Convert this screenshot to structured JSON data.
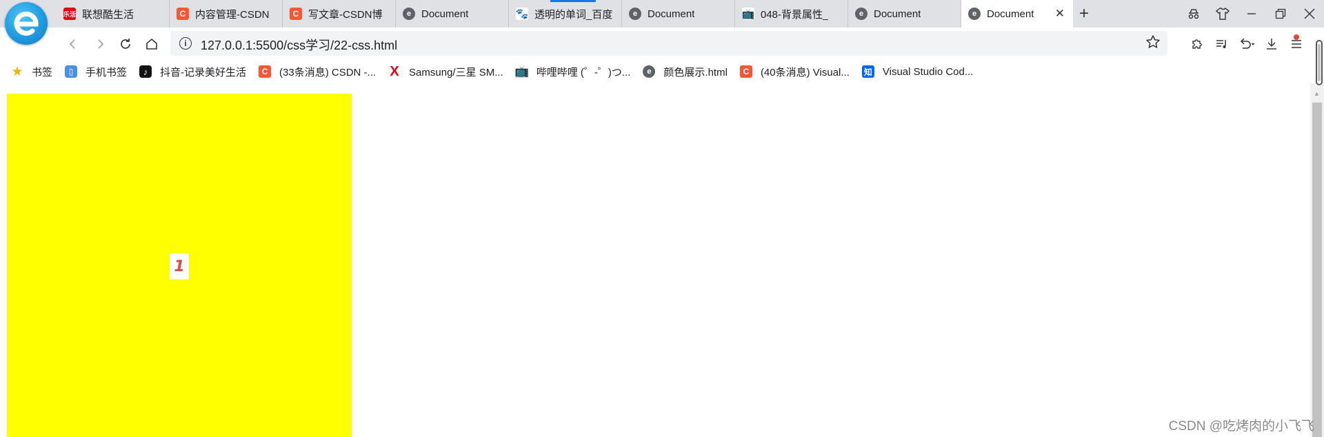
{
  "browser": {
    "tabs": [
      {
        "title": "联想酷生活",
        "favicon": "lenovo-icon",
        "favicon_text": "乐活"
      },
      {
        "title": "内容管理-CSDN",
        "favicon": "csdn-icon",
        "favicon_text": "C"
      },
      {
        "title": "写文章-CSDN博",
        "favicon": "csdn-icon",
        "favicon_text": "C"
      },
      {
        "title": "Document",
        "favicon": "document-icon",
        "favicon_text": "e"
      },
      {
        "title": "透明的单词_百度",
        "favicon": "baidu-icon",
        "favicon_text": "🐾"
      },
      {
        "title": "Document",
        "favicon": "document-icon",
        "favicon_text": "e"
      },
      {
        "title": "048-背景属性_",
        "favicon": "bilibili-icon",
        "favicon_text": "📺"
      },
      {
        "title": "Document",
        "favicon": "document-icon",
        "favicon_text": "e"
      },
      {
        "title": "Document",
        "favicon": "document-icon",
        "favicon_text": "e",
        "active": true
      }
    ],
    "close_glyph": "✕",
    "new_tab_glyph": "+",
    "address_bar": {
      "url": "127.0.0.1:5500/css学习/22-css.html",
      "info_glyph": "i"
    }
  },
  "bookmarks": [
    {
      "label": "书签",
      "icon": "star-icon",
      "glyph": "★"
    },
    {
      "label": "手机书签",
      "icon": "phone-icon",
      "glyph": "▯"
    },
    {
      "label": "抖音-记录美好生活",
      "icon": "tiktok-icon",
      "glyph": "♪"
    },
    {
      "label": "(33条消息) CSDN -...",
      "icon": "csdn-icon",
      "glyph": "C"
    },
    {
      "label": "Samsung/三星 SM...",
      "icon": "x-icon",
      "glyph": "X"
    },
    {
      "label": "哔哩哔哩 (゜-゜)つ...",
      "icon": "bilibili-icon",
      "glyph": "📺"
    },
    {
      "label": "颜色展示.html",
      "icon": "document-icon",
      "glyph": "e"
    },
    {
      "label": "(40条消息) Visual...",
      "icon": "csdn-icon",
      "glyph": "C"
    },
    {
      "label": "Visual Studio Cod...",
      "icon": "zhihu-icon",
      "glyph": "知"
    }
  ],
  "content": {
    "box_color": "#ffff00",
    "box_number": "1"
  },
  "watermark": "CSDN @吃烤肉的小飞飞"
}
